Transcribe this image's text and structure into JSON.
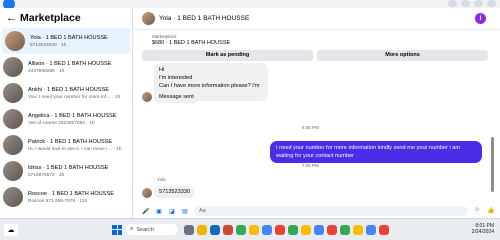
{
  "marketplace": {
    "title": "Marketplace",
    "conversations": [
      {
        "title": "Yola · 1 BED 1 BATH HOUSSE",
        "preview": "5713523330 · 1h",
        "active": true
      },
      {
        "title": "Allison · 1 BED 1 BATH HOUSSE",
        "preview": "4437695086 · 1h",
        "active": false
      },
      {
        "title": "Ankhi · 1 BED 1 BATH HOUSSE",
        "preview": "You: I need your number for more inf… · 1h",
        "active": false
      },
      {
        "title": "Angelica · 1 BED 1 BATH HOUSSE",
        "preview": "Yes of course 2023917084 · 1h",
        "active": false
      },
      {
        "title": "Patrick · 1 BED 1 BATH HOUSSE",
        "preview": "Hi, I would love to see it. I can move i… · 1h",
        "active": false
      },
      {
        "title": "Idriss · 1 BED 1 BATH HOUSSE",
        "preview": "5715876572 · 2h",
        "active": false
      },
      {
        "title": "Roscoe · 1 BED 1 BATH HOUSSE",
        "preview": "Roscoe 571 355-7878 · 11h",
        "active": false
      }
    ]
  },
  "chat": {
    "header_title": "Yola · 1 BED 1 BATH HOUSSE",
    "info_label": "i",
    "listing_label": "Marketplace",
    "listing_title": "$680 · 1 BED 1 BATH HOUSSE",
    "mark_pending_label": "Mark as pending",
    "more_options_label": "More options",
    "msg1_line1": "Hi",
    "msg1_line2": "I'm interested",
    "msg1_line3": "Can I have more information please? I'm female",
    "msg2": "Message sent",
    "time1": "6:08 PM",
    "out_msg": "I need your number for more information kindly send me your number i am waiting for your contact number",
    "time2": "7:25 PM",
    "sender_name": "Yola",
    "msg3": "5713523330",
    "composer_placeholder": "Aa"
  },
  "taskbar": {
    "search_placeholder": "Search",
    "time": "8:01 PM",
    "date": "2/24/2024"
  }
}
